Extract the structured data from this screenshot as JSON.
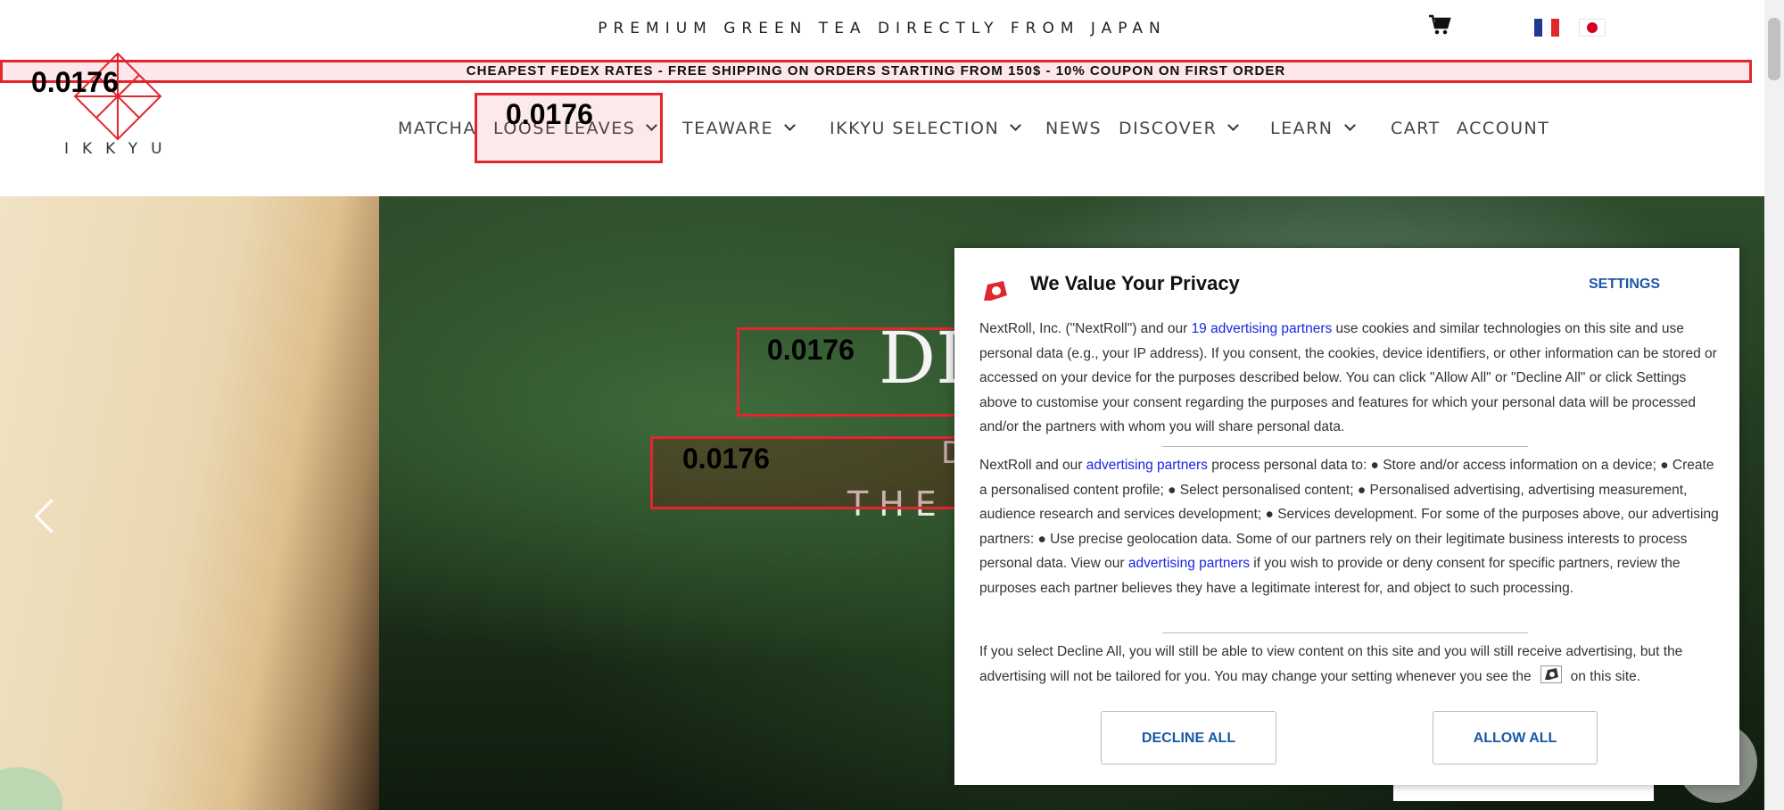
{
  "header": {
    "tagline": "PREMIUM GREEN TEA DIRECTLY FROM JAPAN",
    "cart_icon": "cart-icon",
    "flags": [
      "french-flag-icon",
      "japanese-flag-icon"
    ]
  },
  "promo_bar": {
    "text": "CHEAPEST FEDEX RATES - FREE SHIPPING ON ORDERS STARTING FROM 150$ - 10% COUPON ON FIRST ORDER"
  },
  "logo": {
    "text": "IKKYU",
    "color": "#e2262e"
  },
  "nav": {
    "items": [
      {
        "label": "MATCHA"
      },
      {
        "label": "LOOSE LEAVES"
      },
      {
        "label": "TEAWARE"
      },
      {
        "label": "IKKYU SELECTION"
      },
      {
        "label": "NEWS"
      },
      {
        "label": "DISCOVER"
      },
      {
        "label": "LEARN"
      },
      {
        "label": "CART"
      },
      {
        "label": "ACCOUNT"
      }
    ]
  },
  "overlay_scores": [
    "0.0176",
    "0.0176",
    "0.0176",
    "0.0176"
  ],
  "hero": {
    "title": "DI",
    "subtitle_1": "D",
    "subtitle_2": "THE"
  },
  "consent": {
    "title": "We Value Your Privacy",
    "settings_label": "SETTINGS",
    "p1": {
      "pre": "NextRoll, Inc. (\"NextRoll\") and our ",
      "link": "19 advertising partners",
      "post": " use cookies and similar technologies on this site and use personal data (e.g., your IP address). If you consent, the cookies, device identifiers, or other information can be stored or accessed on your device for the purposes described below. You can click \"Allow All\" or \"Decline All\" or click Settings above to customise your consent regarding the purposes and features for which your personal data will be processed and/or the partners with whom you will share personal data."
    },
    "p2": {
      "pre": "NextRoll and our ",
      "link1": "advertising partners",
      "mid": " process personal data to: ● Store and/or access information on a device; ● Create a personalised content profile; ● Select personalised content; ● Personalised advertising, advertising measurement, audience research and services development; ● Services development. For some of the purposes above, our advertising partners: ● Use precise geolocation data. Some of our partners rely on their legitimate business interests to process personal data. View our ",
      "link2": "advertising partners",
      "post": " if you wish to provide or deny consent for specific partners, review the purposes each partner believes they have a legitimate interest for, and object to such processing."
    },
    "p3": {
      "pre": "If you select Decline All, you will still be able to view content on this site and you will still receive advertising, but the advertising will not be tailored for you. You may change your setting whenever you see the",
      "post": "on this site."
    },
    "decline_label": "DECLINE ALL",
    "allow_label": "ALLOW ALL"
  }
}
